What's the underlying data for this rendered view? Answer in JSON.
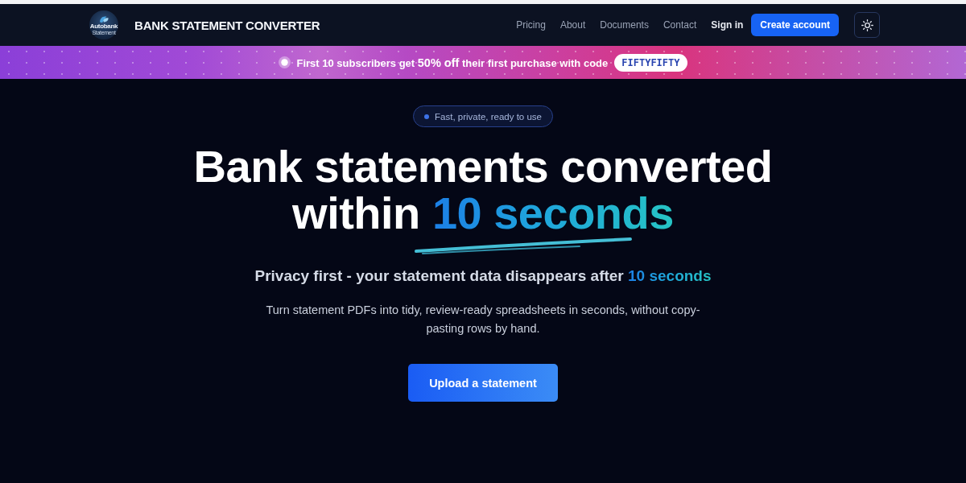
{
  "header": {
    "logo": {
      "line_1": "Autobank",
      "line_2": "Statement"
    },
    "title": "BANK STATEMENT CONVERTER",
    "nav_links": [
      "Pricing",
      "About",
      "Documents",
      "Contact"
    ],
    "sign_in": "Sign in",
    "cta_button": "Create account"
  },
  "promo_banner": {
    "text": "First 10 subscribers get **50% off** their first purchase with code",
    "code": "FIFTYFIFTY"
  },
  "hero": {
    "badge": "Fast, private, ready to use",
    "headline_line_1": "Bank statements converted",
    "headline_line_2": "within",
    "headline_highlight": "10 seconds",
    "subheadline": "Privacy first - your statement data disappears after",
    "subheadline_highlight": "10 seconds",
    "description": "Turn statement PDFs into tidy, review-ready spreadsheets in seconds, without copy-pasting rows by hand.",
    "upload_button": "Upload a statement"
  }
}
